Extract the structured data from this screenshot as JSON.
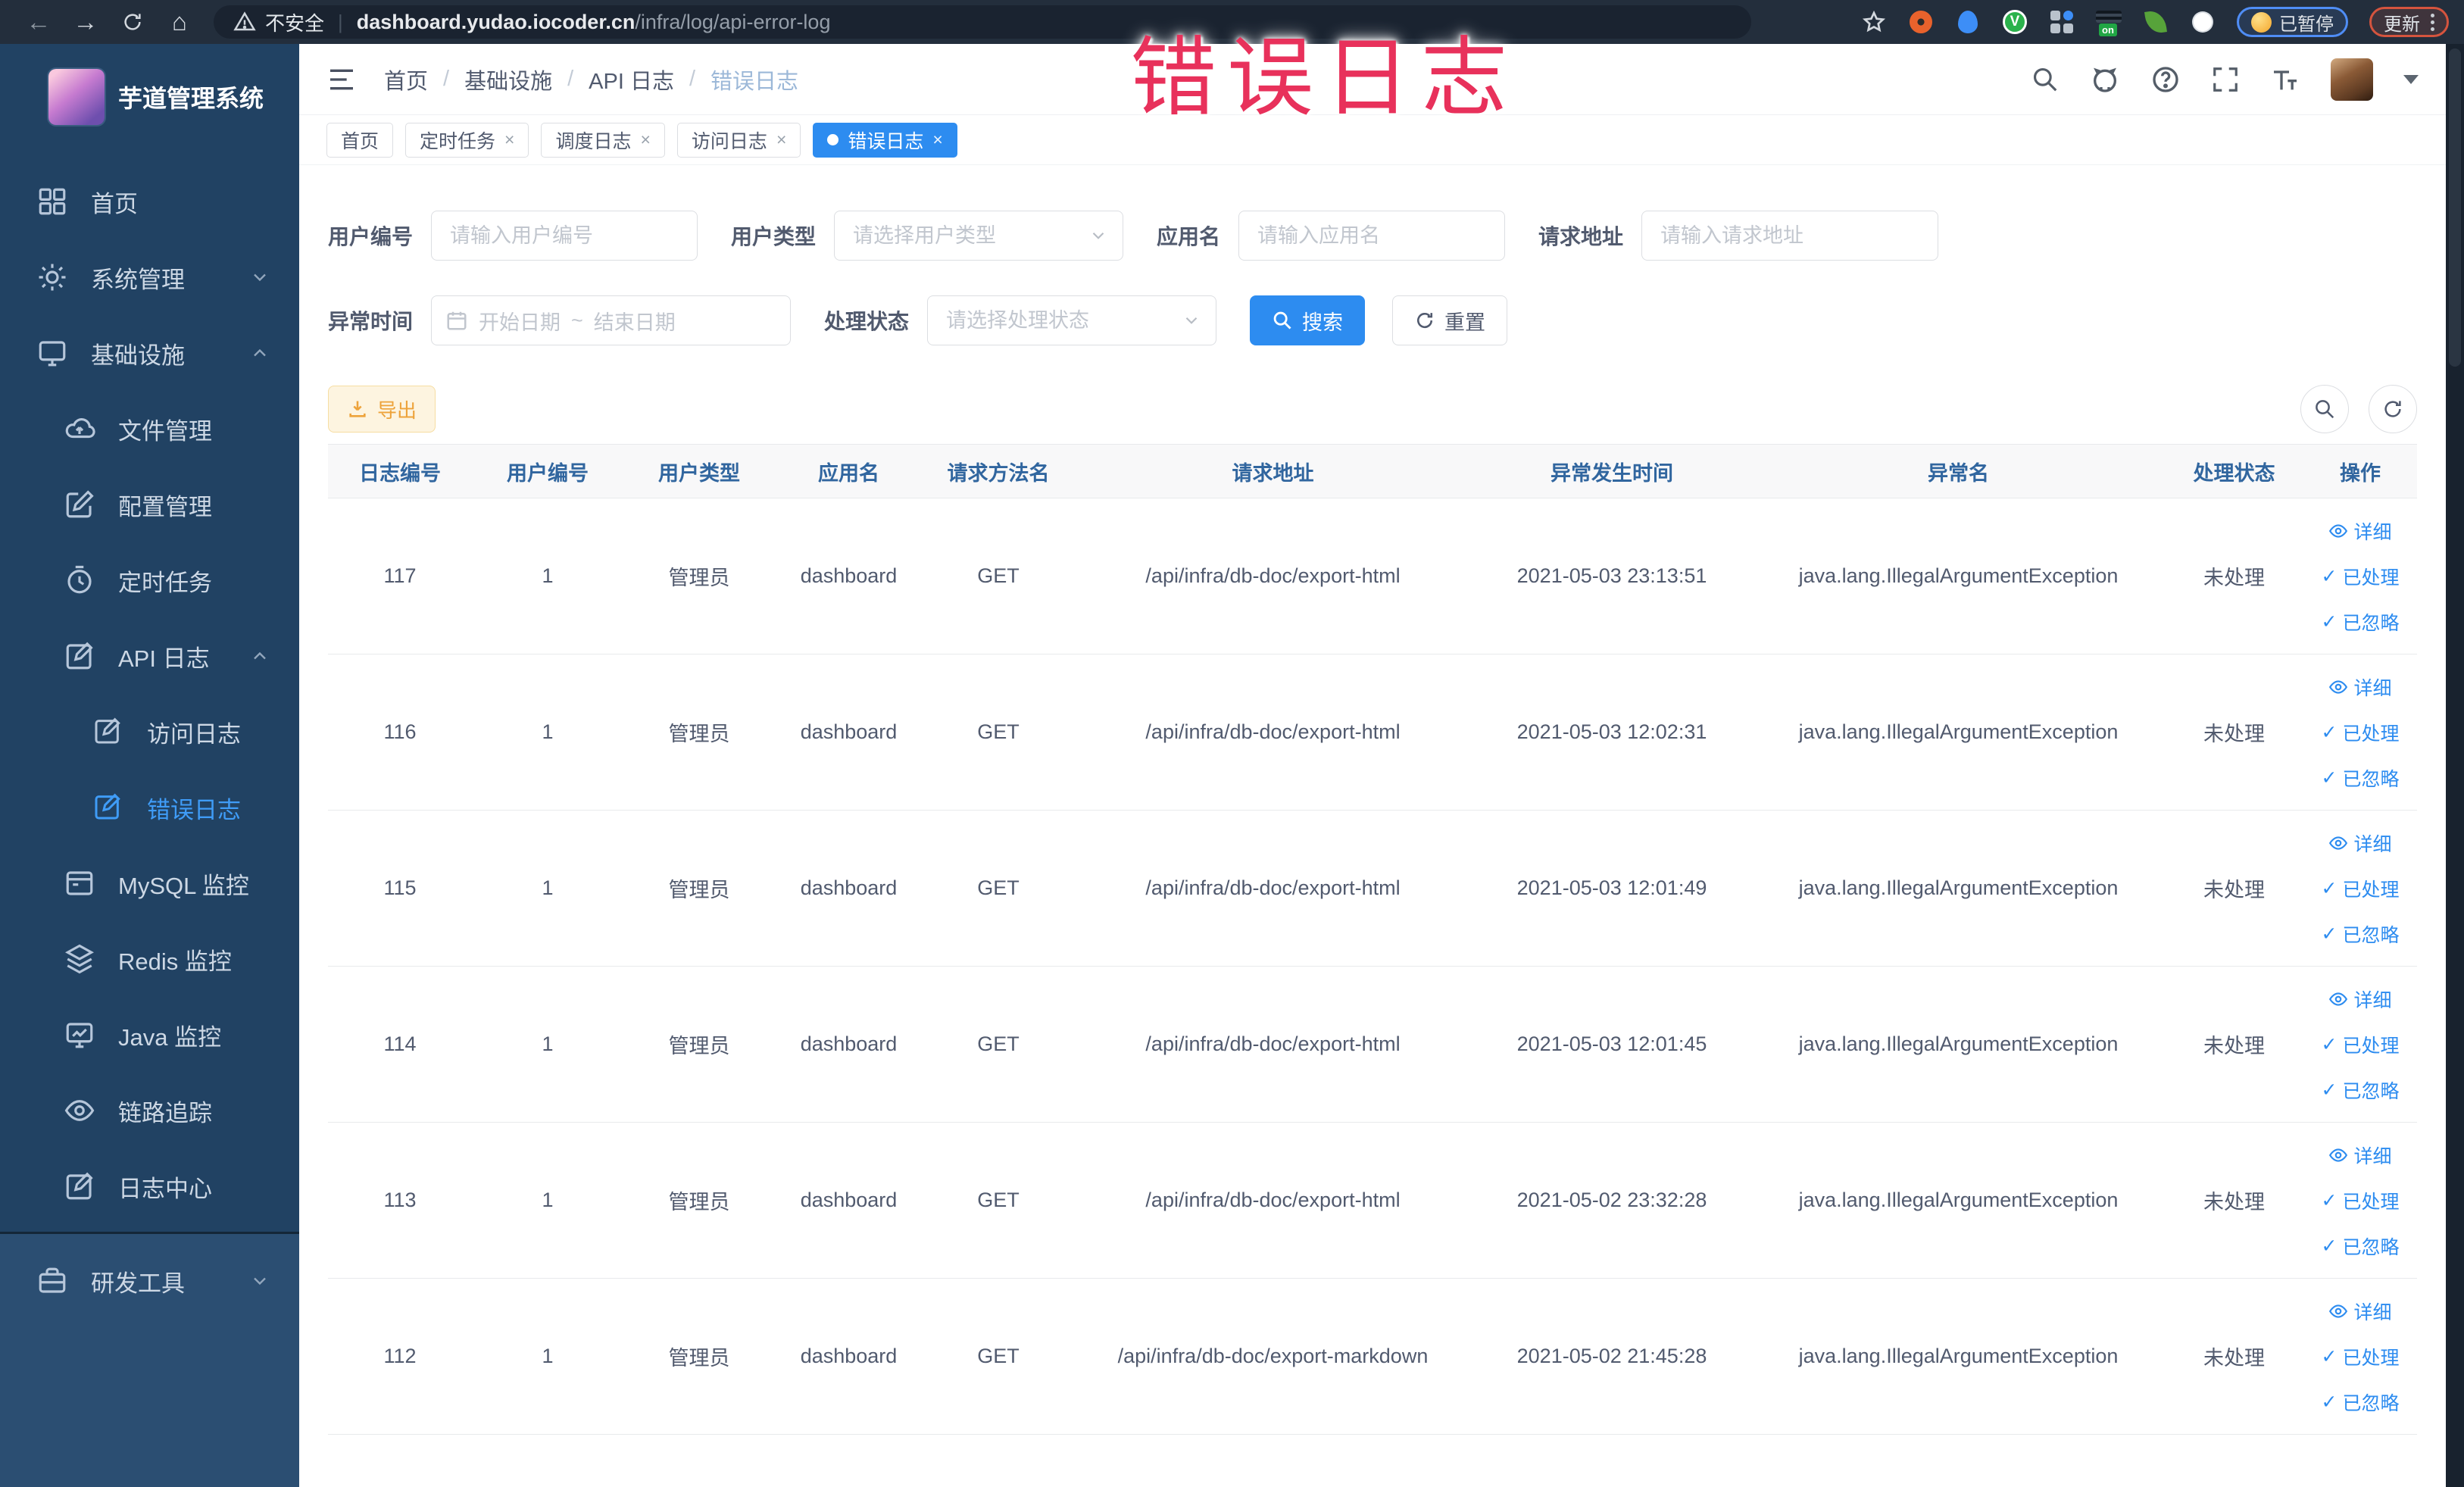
{
  "browser": {
    "security_label": "不安全",
    "url_host": "dashboard.yudao.iocoder.cn",
    "url_path": "/infra/log/api-error-log",
    "on_badge": "on",
    "paused_pill": "已暂停",
    "update_pill": "更新"
  },
  "overlay": {
    "title": "错误日志",
    "color": "#e8315b"
  },
  "icons": {
    "check": "✓",
    "close": "×",
    "back": "←",
    "forward": "→",
    "home": "⌂",
    "v_letter": "V"
  },
  "sidebar": {
    "app_title": "芋道管理系统",
    "items": [
      {
        "label": "首页"
      },
      {
        "label": "系统管理"
      },
      {
        "label": "基础设施"
      },
      {
        "label": "文件管理"
      },
      {
        "label": "配置管理"
      },
      {
        "label": "定时任务"
      },
      {
        "label": "API 日志"
      },
      {
        "label": "访问日志"
      },
      {
        "label": "错误日志"
      },
      {
        "label": "MySQL 监控"
      },
      {
        "label": "Redis 监控"
      },
      {
        "label": "Java 监控"
      },
      {
        "label": "链路追踪"
      },
      {
        "label": "日志中心"
      },
      {
        "label": "研发工具"
      }
    ]
  },
  "breadcrumb": {
    "separator": "/",
    "items": [
      {
        "label": "首页"
      },
      {
        "label": "基础设施"
      },
      {
        "label": "API 日志"
      },
      {
        "label": "错误日志"
      }
    ]
  },
  "tabs": [
    {
      "label": "首页"
    },
    {
      "label": "定时任务"
    },
    {
      "label": "调度日志"
    },
    {
      "label": "访问日志"
    },
    {
      "label": "错误日志"
    }
  ],
  "filters": {
    "user_id_label": "用户编号",
    "user_id_placeholder": "请输入用户编号",
    "user_type_label": "用户类型",
    "user_type_placeholder": "请选择用户类型",
    "app_name_label": "应用名",
    "app_name_placeholder": "请输入应用名",
    "request_url_label": "请求地址",
    "request_url_placeholder": "请输入请求地址",
    "exception_time_label": "异常时间",
    "start_date_placeholder": "开始日期",
    "range_separator": "~",
    "end_date_placeholder": "结束日期",
    "process_status_label": "处理状态",
    "process_status_placeholder": "请选择处理状态",
    "search_button": "搜索",
    "reset_button": "重置"
  },
  "toolbar": {
    "export_button": "导出"
  },
  "table": {
    "columns": [
      "日志编号",
      "用户编号",
      "用户类型",
      "应用名",
      "请求方法名",
      "请求地址",
      "异常发生时间",
      "异常名",
      "处理状态",
      "操作"
    ],
    "actions": {
      "detail": "详细",
      "processed": "已处理",
      "ignored": "已忽略"
    },
    "rows": [
      {
        "id": "117",
        "user_id": "1",
        "user_type": "管理员",
        "app": "dashboard",
        "method": "GET",
        "url": "/api/infra/db-doc/export-html",
        "time": "2021-05-03 23:13:51",
        "exception": "java.lang.IllegalArgumentException",
        "status": "未处理"
      },
      {
        "id": "116",
        "user_id": "1",
        "user_type": "管理员",
        "app": "dashboard",
        "method": "GET",
        "url": "/api/infra/db-doc/export-html",
        "time": "2021-05-03 12:02:31",
        "exception": "java.lang.IllegalArgumentException",
        "status": "未处理"
      },
      {
        "id": "115",
        "user_id": "1",
        "user_type": "管理员",
        "app": "dashboard",
        "method": "GET",
        "url": "/api/infra/db-doc/export-html",
        "time": "2021-05-03 12:01:49",
        "exception": "java.lang.IllegalArgumentException",
        "status": "未处理"
      },
      {
        "id": "114",
        "user_id": "1",
        "user_type": "管理员",
        "app": "dashboard",
        "method": "GET",
        "url": "/api/infra/db-doc/export-html",
        "time": "2021-05-03 12:01:45",
        "exception": "java.lang.IllegalArgumentException",
        "status": "未处理"
      },
      {
        "id": "113",
        "user_id": "1",
        "user_type": "管理员",
        "app": "dashboard",
        "method": "GET",
        "url": "/api/infra/db-doc/export-html",
        "time": "2021-05-02 23:32:28",
        "exception": "java.lang.IllegalArgumentException",
        "status": "未处理"
      },
      {
        "id": "112",
        "user_id": "1",
        "user_type": "管理员",
        "app": "dashboard",
        "method": "GET",
        "url": "/api/infra/db-doc/export-markdown",
        "time": "2021-05-02 21:45:28",
        "exception": "java.lang.IllegalArgumentException",
        "status": "未处理"
      }
    ]
  },
  "colors": {
    "accent": "#2d8cf0",
    "sidebar_bg": "#214263",
    "chrome_bg": "#232e3c",
    "header_text": "#31669f",
    "warning_button": "#eda33b"
  }
}
